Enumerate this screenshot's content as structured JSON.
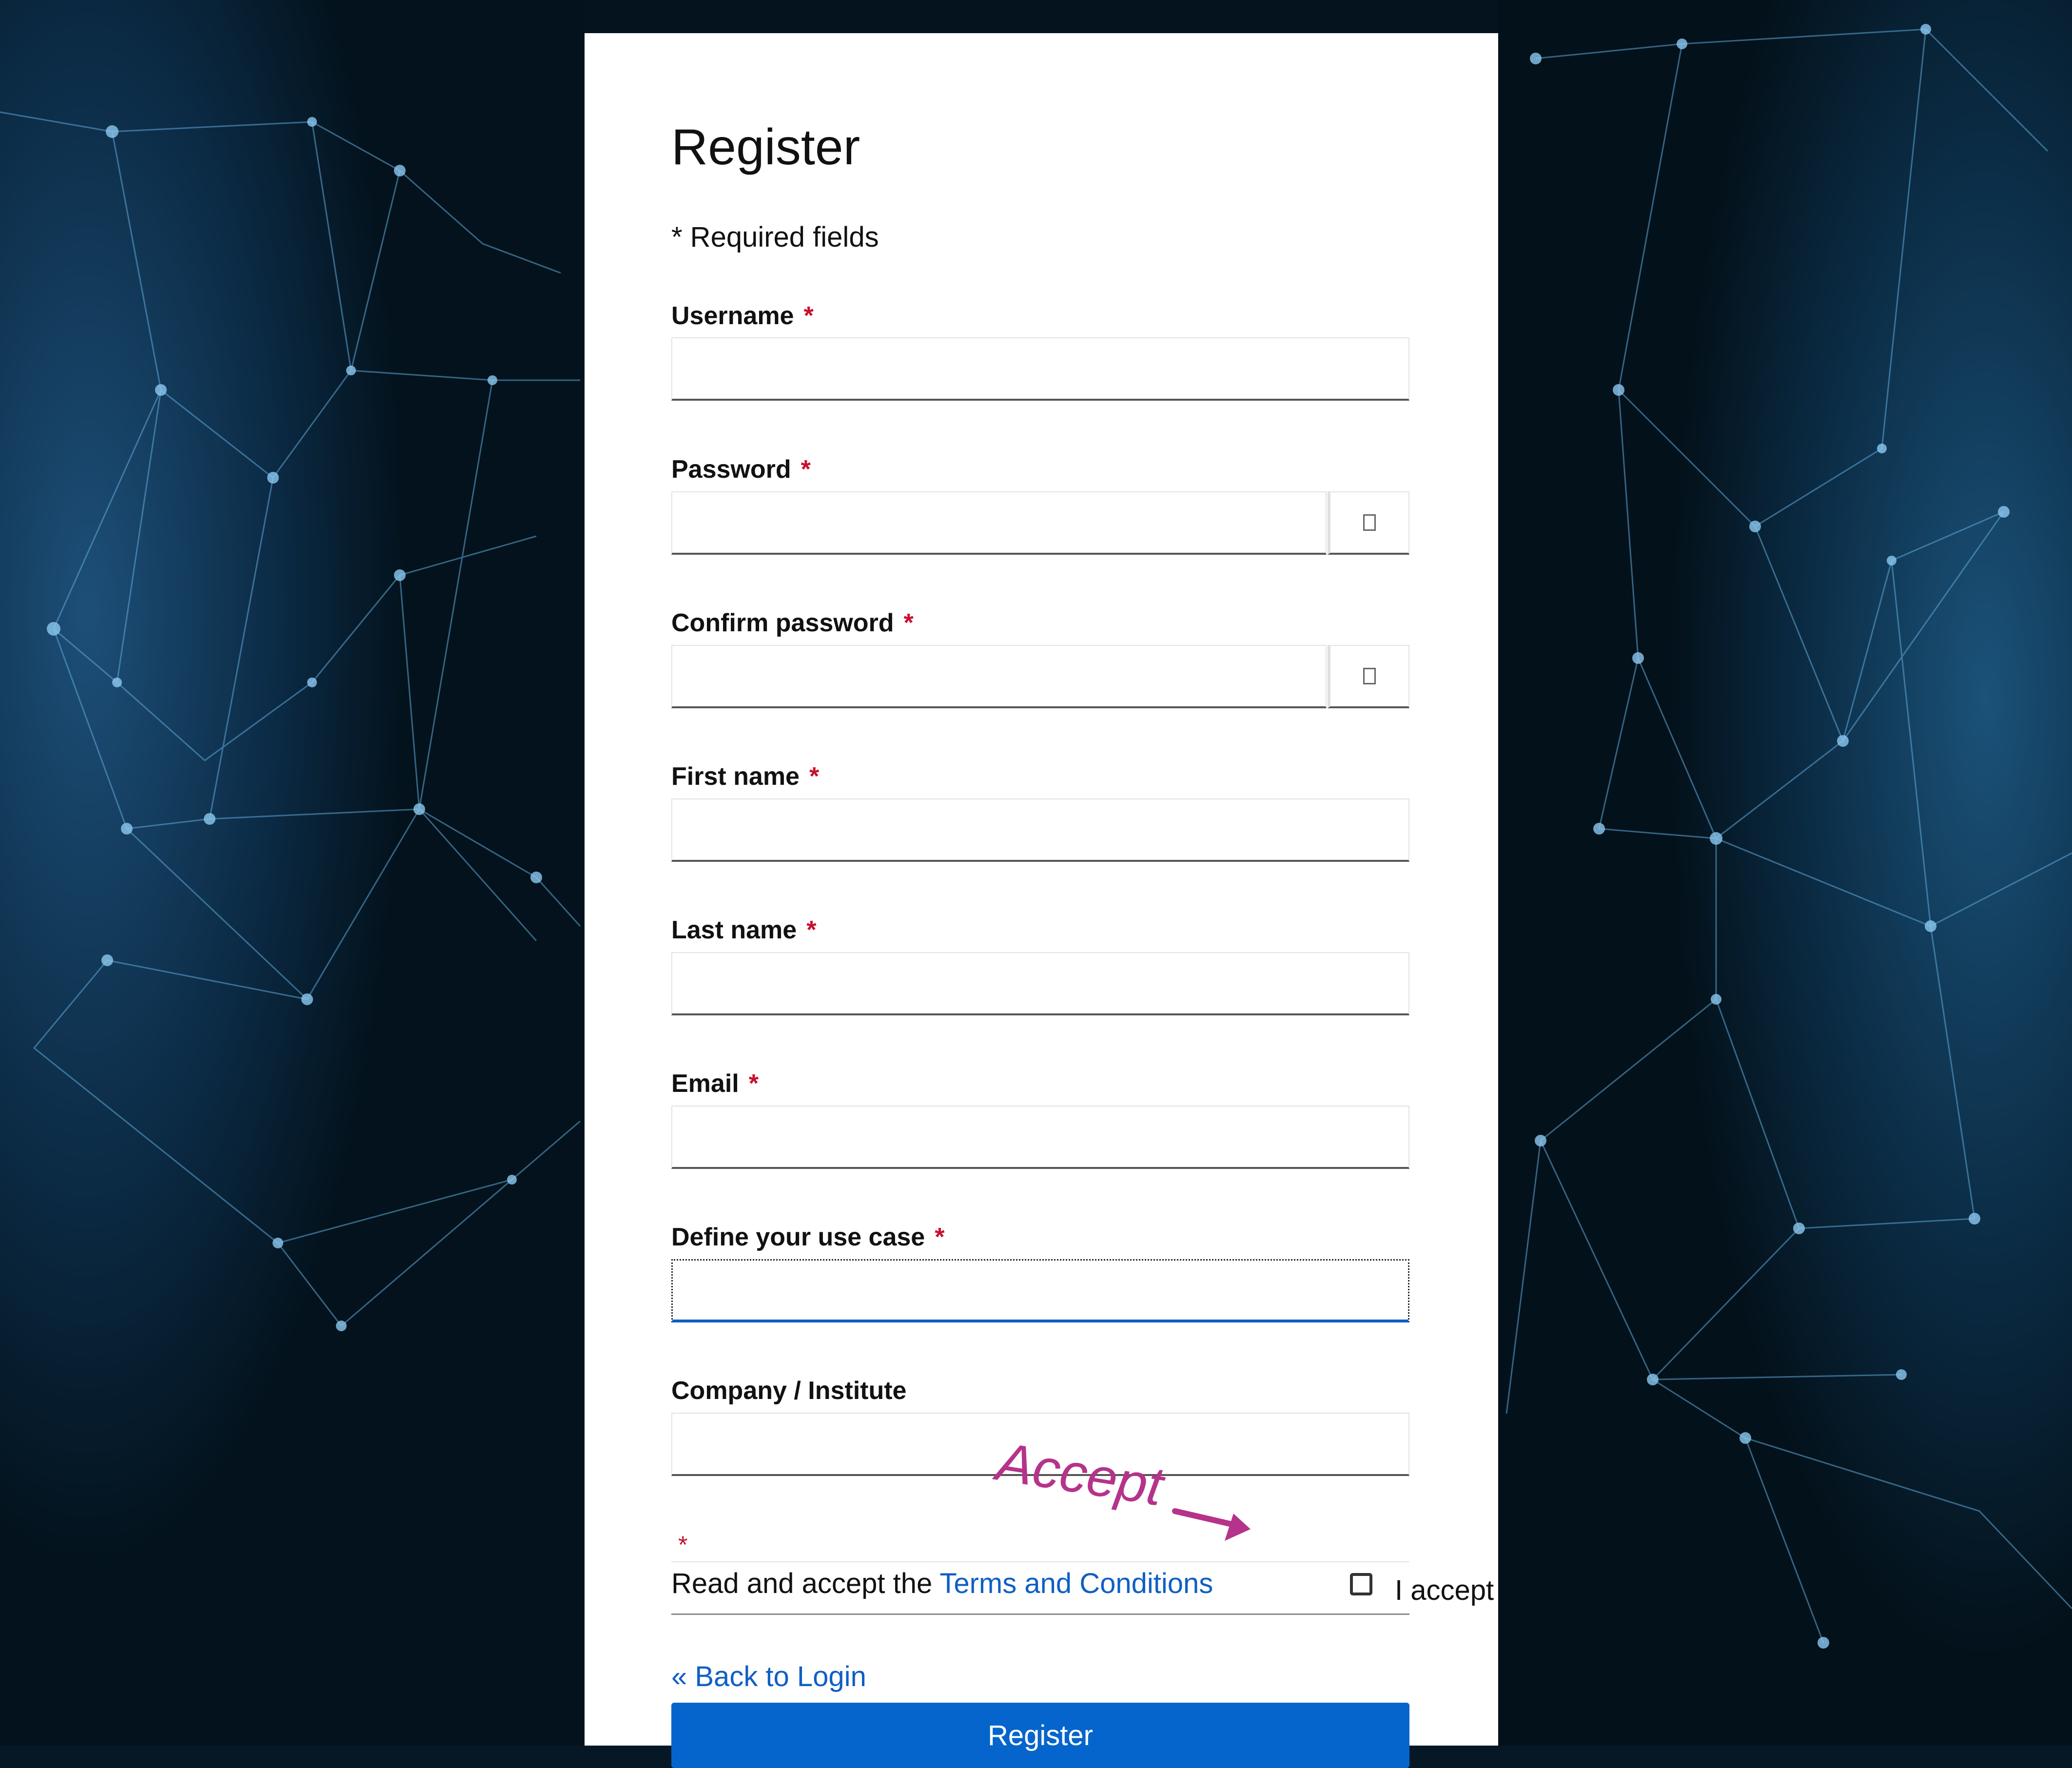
{
  "form": {
    "title": "Register",
    "required_note": "* Required fields",
    "required_marker": "*",
    "fields": [
      {
        "label": "Username",
        "required": true,
        "value": ""
      },
      {
        "label": "Password",
        "required": true,
        "value": "",
        "type": "password"
      },
      {
        "label": "Confirm password",
        "required": true,
        "value": "",
        "type": "password"
      },
      {
        "label": "First name",
        "required": true,
        "value": ""
      },
      {
        "label": "Last name",
        "required": true,
        "value": ""
      },
      {
        "label": "Email",
        "required": true,
        "value": ""
      },
      {
        "label": "Define your use case",
        "required": true,
        "value": "",
        "focused": true
      },
      {
        "label": "Company / Institute",
        "required": false,
        "value": ""
      }
    ],
    "terms": {
      "prefix": "Read and accept the ",
      "link_text": "Terms and Conditions",
      "checkbox_label": "I accept",
      "checked": false
    },
    "back_link": "« Back to Login",
    "submit_label": "Register"
  },
  "annotation": {
    "text": "Accept",
    "color": "#b5338a"
  },
  "colors": {
    "accent": "#0565cc",
    "link": "#0f5fc4",
    "required": "#c8102e",
    "background": "#061826"
  },
  "icons": {
    "password_reveal": "eye-icon"
  }
}
